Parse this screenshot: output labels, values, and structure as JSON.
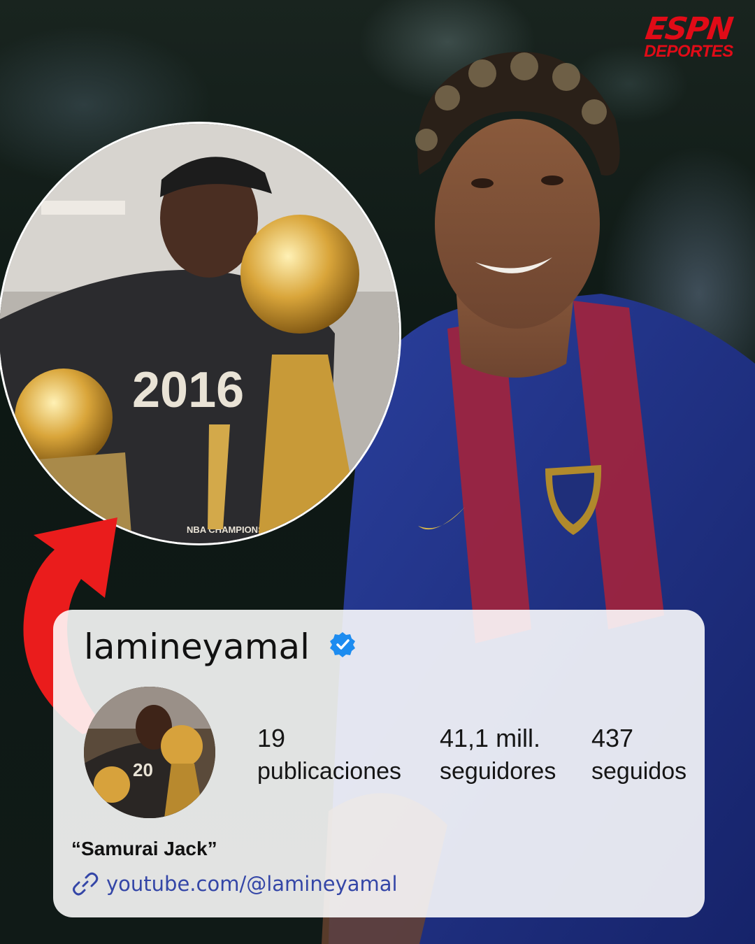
{
  "brand": {
    "line1": "ESPN",
    "line2": "DEPORTES"
  },
  "inset_photo": {
    "jersey_year": "2016",
    "caption": "NBA CHAMPIONS"
  },
  "profile": {
    "username": "lamineyamal",
    "verified": true,
    "stats": [
      {
        "value": "19",
        "label": "publicaciones"
      },
      {
        "value": "41,1 mill.",
        "label": "seguidores"
      },
      {
        "value": "437",
        "label": "seguidos"
      }
    ],
    "bio": "“Samurai Jack”",
    "link": "youtube.com/@lamineyamal"
  },
  "colors": {
    "brand_red": "#e10b17",
    "verified_blue": "#1d8cf0",
    "link_blue": "#3446a7",
    "arrow_red": "#ea1c1c"
  },
  "icons": {
    "verified": "verified-badge-icon",
    "link": "link-chain-icon",
    "arrow": "curved-arrow-icon"
  }
}
